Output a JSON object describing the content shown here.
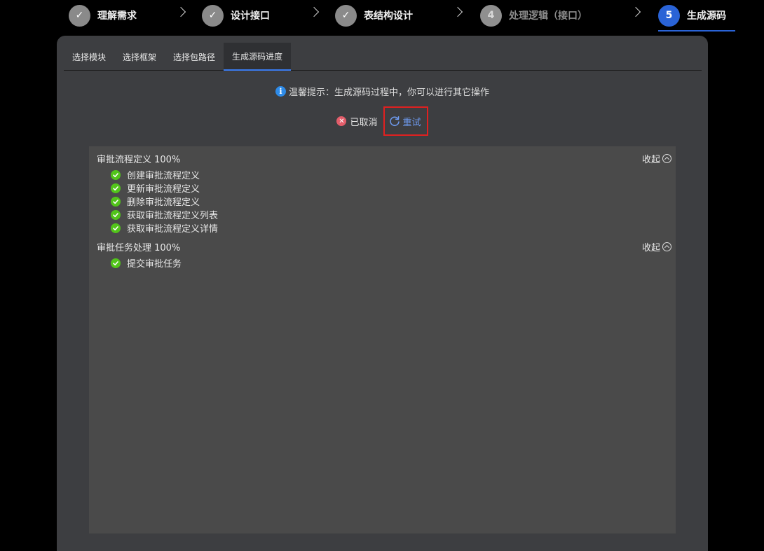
{
  "steps": [
    {
      "label": "理解需求",
      "status": "done",
      "marker": "✓"
    },
    {
      "label": "设计接口",
      "status": "done",
      "marker": "✓"
    },
    {
      "label": "表结构设计",
      "status": "done",
      "marker": "✓"
    },
    {
      "label": "处理逻辑（接口）",
      "status": "pending",
      "marker": "4"
    },
    {
      "label": "生成源码",
      "status": "active",
      "marker": "5"
    }
  ],
  "tabs": [
    {
      "label": "选择模块",
      "active": false
    },
    {
      "label": "选择框架",
      "active": false
    },
    {
      "label": "选择包路径",
      "active": false
    },
    {
      "label": "生成源码进度",
      "active": true
    }
  ],
  "hint": {
    "text": "温馨提示：生成源码过程中，你可以进行其它操作",
    "icon": "info-icon"
  },
  "status": {
    "cancel_label": "已取消",
    "retry_label": "重试"
  },
  "colors": {
    "accent": "#2a63d6",
    "success": "#52c41a",
    "danger": "#e35d6a",
    "link": "#6f9cf2",
    "highlight_border": "#e02020"
  },
  "groups": [
    {
      "title": "审批流程定义 100%",
      "collapse_label": "收起",
      "items": [
        "创建审批流程定义",
        "更新审批流程定义",
        "删除审批流程定义",
        "获取审批流程定义列表",
        "获取审批流程定义详情"
      ]
    },
    {
      "title": "审批任务处理 100%",
      "collapse_label": "收起",
      "items": [
        "提交审批任务"
      ]
    }
  ]
}
